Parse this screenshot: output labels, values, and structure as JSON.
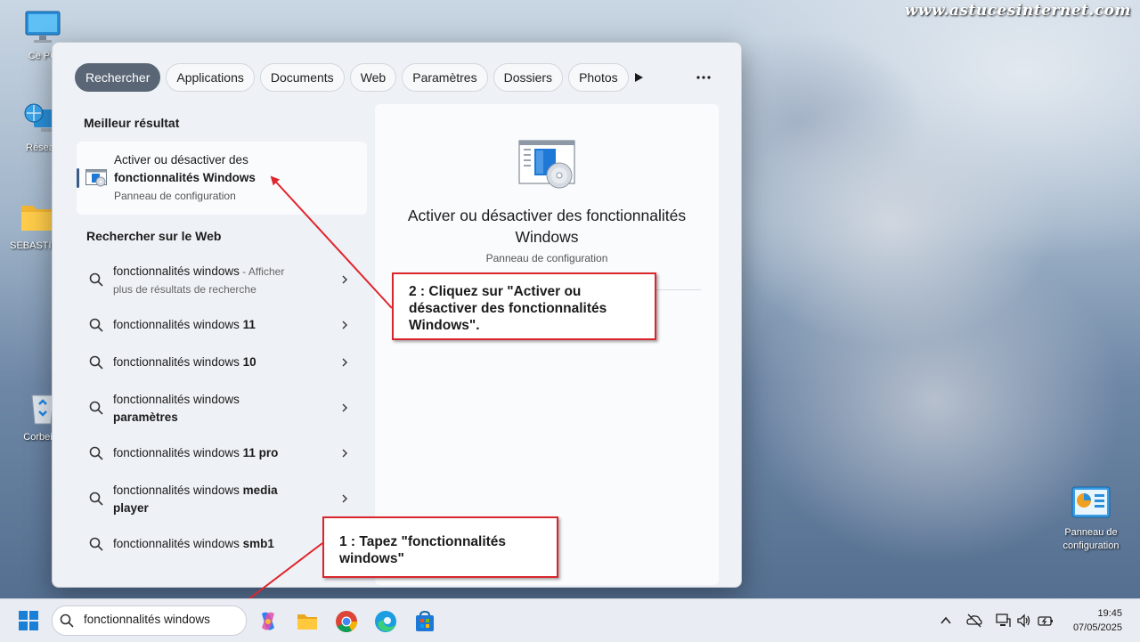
{
  "watermark": "www.astucesinternet.com",
  "desktop": {
    "icons": [
      {
        "label": "Ce PC"
      },
      {
        "label": "Réseau"
      },
      {
        "label": "SEBASTIEN"
      },
      {
        "label": "Corbeille"
      },
      {
        "label": "Panneau de configuration"
      }
    ]
  },
  "search_panel": {
    "tabs": [
      {
        "label": "Rechercher",
        "active": true
      },
      {
        "label": "Applications"
      },
      {
        "label": "Documents"
      },
      {
        "label": "Web"
      },
      {
        "label": "Paramètres"
      },
      {
        "label": "Dossiers"
      },
      {
        "label": "Photos"
      }
    ],
    "play_icon": "play-icon",
    "more_icon": "more-icon",
    "best_match_heading": "Meilleur résultat",
    "best_match": {
      "title_line1": "Activer ou désactiver des",
      "title_line2": "fonctionnalités Windows",
      "subtitle": "Panneau de configuration",
      "icon": "windows-features-icon"
    },
    "web_heading": "Rechercher sur le Web",
    "web_results": [
      {
        "base": "fonctionnalités windows",
        "suffix": "",
        "extra": " - Afficher",
        "extra2": "plus de résultats de recherche"
      },
      {
        "base": "fonctionnalités windows",
        "suffix": "11"
      },
      {
        "base": "fonctionnalités windows",
        "suffix": "10"
      },
      {
        "base": "fonctionnalités windows",
        "suffix": "paramètres"
      },
      {
        "base": "fonctionnalités windows",
        "suffix": "11 pro"
      },
      {
        "base": "fonctionnalités windows",
        "suffix": "media player"
      },
      {
        "base": "fonctionnalités windows",
        "suffix": "smb1"
      }
    ],
    "preview": {
      "title": "Activer ou désactiver des fonctionnalités Windows",
      "subtitle": "Panneau de configuration"
    }
  },
  "callouts": {
    "step2": "2 : Cliquez sur \"Activer ou désactiver des fonctionnalités Windows\".",
    "step1": "1 : Tapez \"fonctionnalités windows\""
  },
  "taskbar": {
    "search_value": "fonctionnalités windows",
    "clock_time": "19:45",
    "clock_date": "07/05/2025"
  },
  "colors": {
    "accent": "#5a6675",
    "callout_border": "#d9262c",
    "arrow": "#e0252b"
  }
}
